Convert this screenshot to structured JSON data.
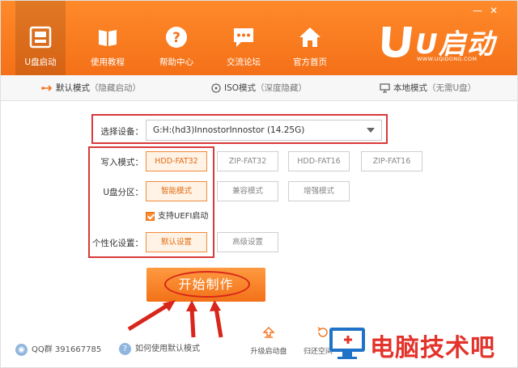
{
  "nav": [
    {
      "label": "U盘启动",
      "icon": "usb-drive-icon"
    },
    {
      "label": "使用教程",
      "icon": "book-icon"
    },
    {
      "label": "帮助中心",
      "icon": "help-icon"
    },
    {
      "label": "交流论坛",
      "icon": "chat-icon"
    },
    {
      "label": "官方首页",
      "icon": "home-icon"
    }
  ],
  "window_controls": {
    "minimize": "—",
    "close": "✕"
  },
  "brand": {
    "logo_text": "U启动",
    "url": "WWW.UQIDONG.COM"
  },
  "tabs": [
    {
      "main": "默认模式",
      "sub": "（隐藏启动）",
      "icon": "usb-icon",
      "active": true
    },
    {
      "main": "ISO模式",
      "sub": "（深度隐藏）",
      "icon": "disc-icon",
      "active": false
    },
    {
      "main": "本地模式",
      "sub": "（无需U盘）",
      "icon": "monitor-icon",
      "active": false
    }
  ],
  "device": {
    "label": "选择设备：",
    "value": "G:H:(hd3)InnostorInnostor (14.25G)"
  },
  "write_mode": {
    "label": "写入模式：",
    "options": [
      "HDD-FAT32",
      "ZIP-FAT32",
      "HDD-FAT16",
      "ZIP-FAT16"
    ],
    "selected": 0
  },
  "partition": {
    "label": "U盘分区：",
    "options": [
      "智能模式",
      "兼容模式",
      "增强模式"
    ],
    "selected": 0
  },
  "uefi": {
    "label": "支持UEFI启动",
    "checked": true
  },
  "personalize": {
    "label": "个性化设置：",
    "options": [
      "默认设置",
      "高级设置"
    ],
    "selected": 0
  },
  "start_button": {
    "label": "开始制作"
  },
  "footer": {
    "qq": "QQ群 391667785",
    "help_link": "如何使用默认模式",
    "upgrade": "升级启动盘",
    "restore": "归还空间"
  },
  "watermark": {
    "text": "电脑技术吧"
  },
  "colors": {
    "accent": "#f47018",
    "highlight_red": "#d83a3a",
    "selected_text": "#e26a10"
  }
}
